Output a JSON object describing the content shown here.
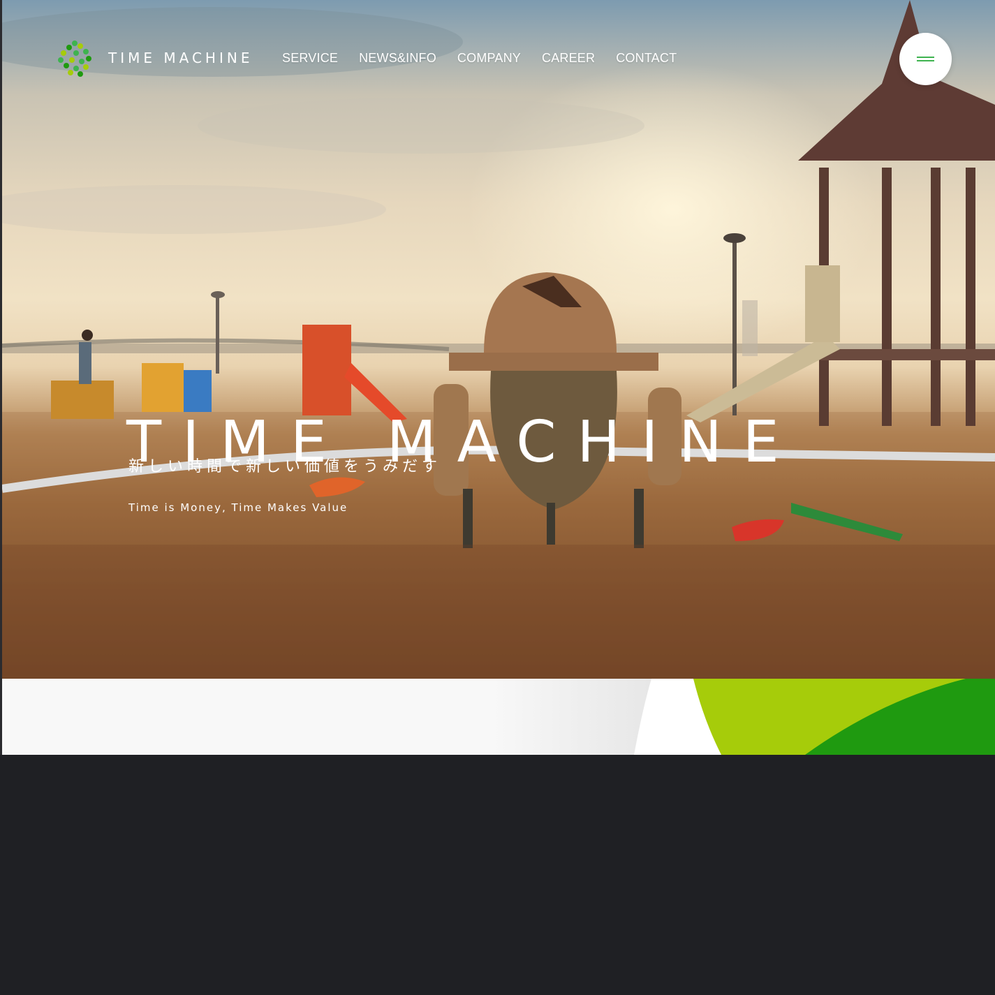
{
  "brand": {
    "name": "TIME MACHINE",
    "logo_icon": "clover-dots-logo",
    "colors": {
      "green": "#3eb34f",
      "lime": "#a6cc0a",
      "dark_green": "#1f9a10"
    }
  },
  "nav": {
    "items": [
      {
        "label": "SERVICE"
      },
      {
        "label": "NEWS&INFO"
      },
      {
        "label": "COMPANY"
      },
      {
        "label": "CAREER"
      },
      {
        "label": "CONTACT"
      }
    ]
  },
  "menu_button": {
    "icon": "hamburger-icon"
  },
  "hero": {
    "title": "TIME MACHINE",
    "tagline_jp": "新しい時間で新しい価値をうみだす",
    "tagline_en": "Time is Money, Time Makes Value"
  }
}
